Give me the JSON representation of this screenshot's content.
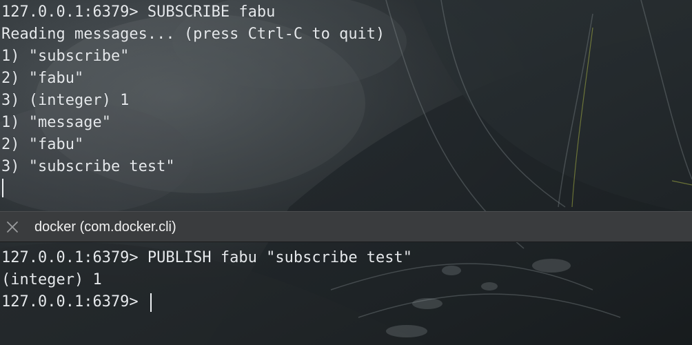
{
  "window": {
    "tab_title": "docker (com.docker.cli)",
    "close_icon": "close-icon"
  },
  "top_pane": {
    "lines": [
      "127.0.0.1:6379> SUBSCRIBE fabu",
      "Reading messages... (press Ctrl-C to quit)",
      "1) \"subscribe\"",
      "2) \"fabu\"",
      "3) (integer) 1",
      "1) \"message\"",
      "2) \"fabu\"",
      "3) \"subscribe test\""
    ]
  },
  "bottom_pane": {
    "lines": [
      "127.0.0.1:6379> PUBLISH fabu \"subscribe test\"",
      "(integer) 1"
    ],
    "prompt": "127.0.0.1:6379> "
  },
  "colors": {
    "text": "#e6e9ec",
    "tab_bar": "#3a3c3e",
    "cursor": "#eef1f3"
  }
}
